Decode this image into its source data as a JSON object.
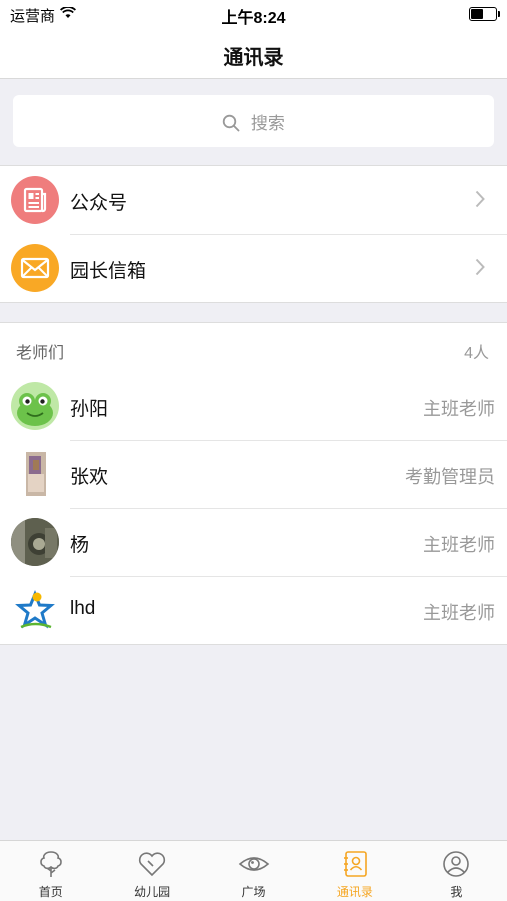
{
  "status_bar": {
    "carrier": "运营商",
    "time": "上午8:24",
    "battery_level": 0.45
  },
  "nav": {
    "title": "通讯录"
  },
  "search": {
    "placeholder": "搜索"
  },
  "shortcuts": [
    {
      "label": "公众号",
      "icon": "newspaper-icon",
      "color": "#ef7d7d"
    },
    {
      "label": "园长信箱",
      "icon": "envelope-icon",
      "color": "#f9a825"
    }
  ],
  "teachers": {
    "header": "老师们",
    "count": "4人",
    "items": [
      {
        "name": "孙阳",
        "role": "主班老师",
        "avatar": "frog-avatar"
      },
      {
        "name": "张欢",
        "role": "考勤管理员",
        "avatar": "photo-avatar"
      },
      {
        "name": "杨",
        "role": "主班老师",
        "avatar": "photo-avatar"
      },
      {
        "name": "lhd",
        "role": "主班老师",
        "avatar": "star-logo-avatar"
      }
    ]
  },
  "tabs": [
    {
      "label": "首页",
      "icon": "tree-icon"
    },
    {
      "label": "幼儿园",
      "icon": "heart-icon"
    },
    {
      "label": "广场",
      "icon": "eye-icon"
    },
    {
      "label": "通讯录",
      "icon": "contacts-icon",
      "active": true
    },
    {
      "label": "我",
      "icon": "user-icon"
    }
  ],
  "colors": {
    "accent": "#f5a623",
    "background": "#efeff4"
  }
}
